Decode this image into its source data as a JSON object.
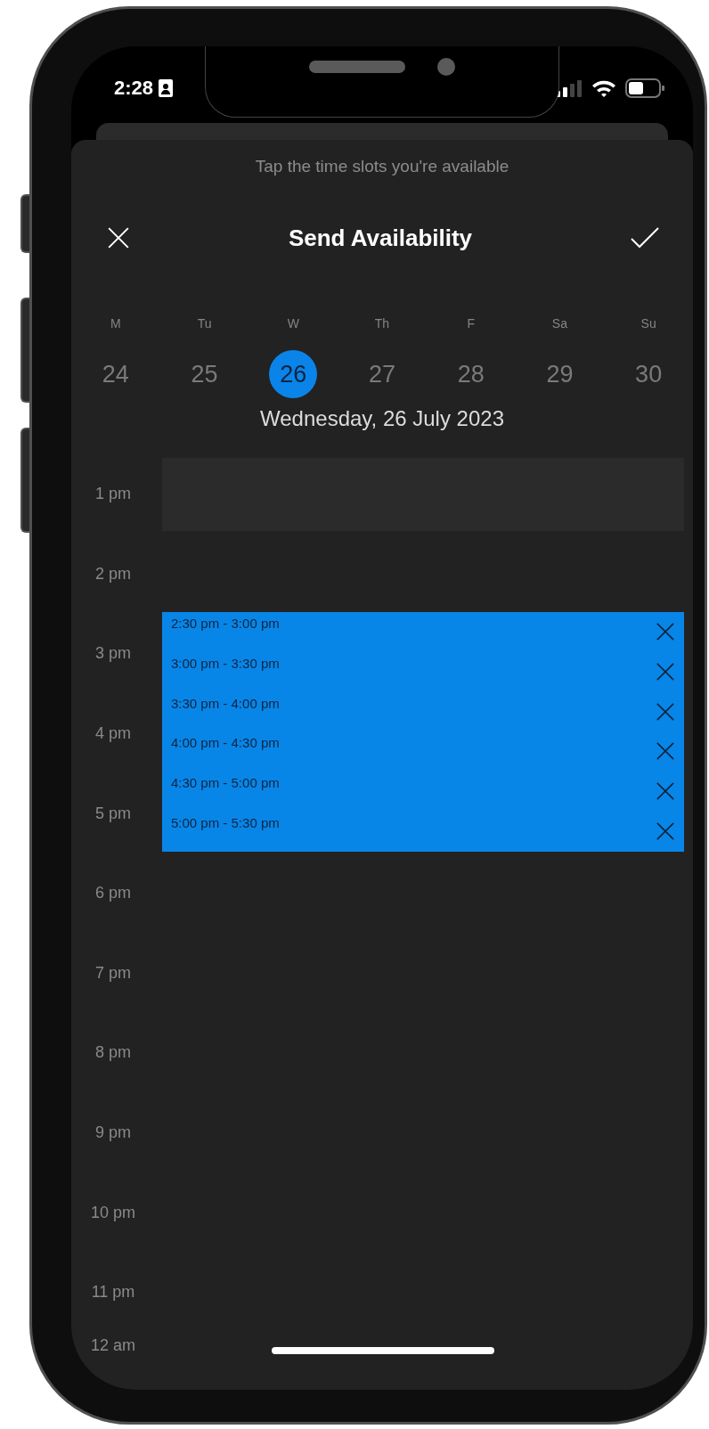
{
  "status_bar": {
    "time": "2:28"
  },
  "sheet": {
    "hint": "Tap the time slots you're available",
    "title": "Send Availability"
  },
  "week": [
    {
      "weekday": "M",
      "date": "24",
      "selected": false
    },
    {
      "weekday": "Tu",
      "date": "25",
      "selected": false
    },
    {
      "weekday": "W",
      "date": "26",
      "selected": true
    },
    {
      "weekday": "Th",
      "date": "27",
      "selected": false
    },
    {
      "weekday": "F",
      "date": "28",
      "selected": false
    },
    {
      "weekday": "Sa",
      "date": "29",
      "selected": false
    },
    {
      "weekday": "Su",
      "date": "30",
      "selected": false
    }
  ],
  "date_label": "Wednesday, 26 July 2023",
  "timeline": {
    "hours": [
      "1 pm",
      "2 pm",
      "3 pm",
      "4 pm",
      "5 pm",
      "6 pm",
      "7 pm",
      "8 pm",
      "9 pm",
      "10 pm",
      "11 pm",
      "12 am"
    ],
    "slots": [
      {
        "label": "2:30 pm - 3:00 pm"
      },
      {
        "label": "3:00 pm - 3:30 pm"
      },
      {
        "label": "3:30 pm - 4:00 pm"
      },
      {
        "label": "4:00 pm - 4:30 pm"
      },
      {
        "label": "4:30 pm - 5:00 pm"
      },
      {
        "label": "5:00 pm - 5:30 pm"
      }
    ]
  }
}
